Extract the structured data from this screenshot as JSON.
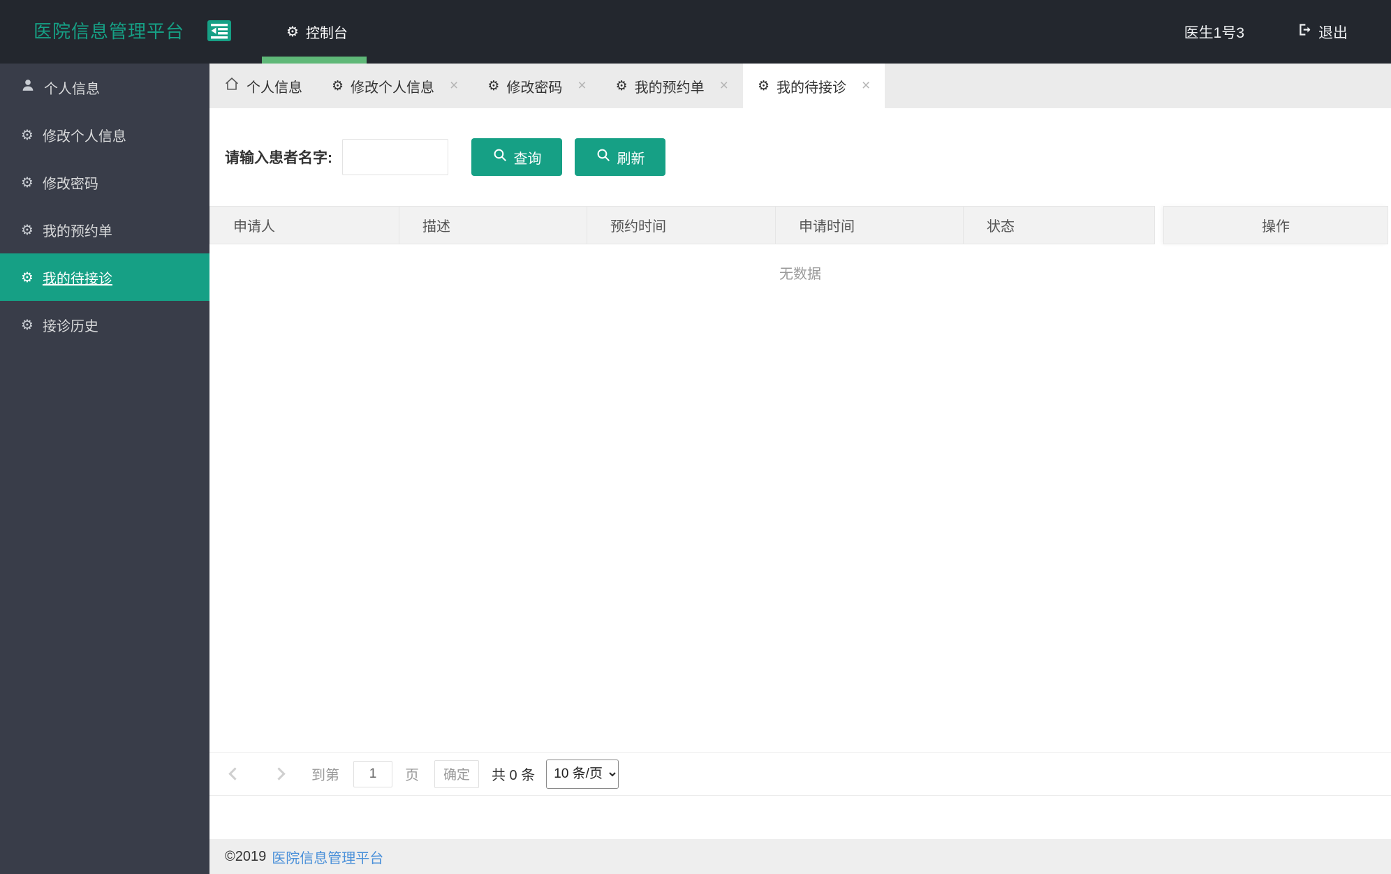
{
  "app": {
    "title": "医院信息管理平台"
  },
  "icons": {
    "gear": "⚙"
  },
  "topbar": {
    "logo": "医院信息管理平台",
    "console": "控制台",
    "username": "医生1号3",
    "logout": "退出"
  },
  "sidebar": {
    "items": [
      {
        "label": "个人信息",
        "icon": "user-icon",
        "active": false
      },
      {
        "label": "修改个人信息",
        "icon": "gear-icon",
        "active": false
      },
      {
        "label": "修改密码",
        "icon": "gear-icon",
        "active": false
      },
      {
        "label": "我的预约单",
        "icon": "gear-icon",
        "active": false
      },
      {
        "label": "我的待接诊",
        "icon": "gear-icon",
        "active": true
      },
      {
        "label": "接诊历史",
        "icon": "gear-icon",
        "active": false
      }
    ]
  },
  "tabs": {
    "close_glyph": "×",
    "items": [
      {
        "label": "个人信息",
        "icon": "home-icon",
        "closable": false,
        "active": false
      },
      {
        "label": "修改个人信息",
        "icon": "gear-icon",
        "closable": true,
        "active": false
      },
      {
        "label": "修改密码",
        "icon": "gear-icon",
        "closable": true,
        "active": false
      },
      {
        "label": "我的预约单",
        "icon": "gear-icon",
        "closable": true,
        "active": false
      },
      {
        "label": "我的待接诊",
        "icon": "gear-icon",
        "closable": true,
        "active": true
      }
    ]
  },
  "search": {
    "label": "请输入患者名字:",
    "value": "",
    "query": "查询",
    "refresh": "刷新"
  },
  "table": {
    "columns": [
      "申请人",
      "描述",
      "预约时间",
      "申请时间",
      "状态",
      "操作"
    ],
    "empty": "无数据",
    "rows": []
  },
  "pagination": {
    "goto": "到第",
    "page": "1",
    "unit": "页",
    "confirm": "确定",
    "total": "共 0 条",
    "size": "10 条/页"
  },
  "footer": {
    "copyright": "©2019",
    "link": "医院信息管理平台"
  },
  "colors": {
    "accent_teal": "#16a085",
    "indicator_green": "#5FB878",
    "topbar_bg": "#23272e",
    "sidebar_bg": "#393d49",
    "link_blue": "#4a90d9"
  }
}
